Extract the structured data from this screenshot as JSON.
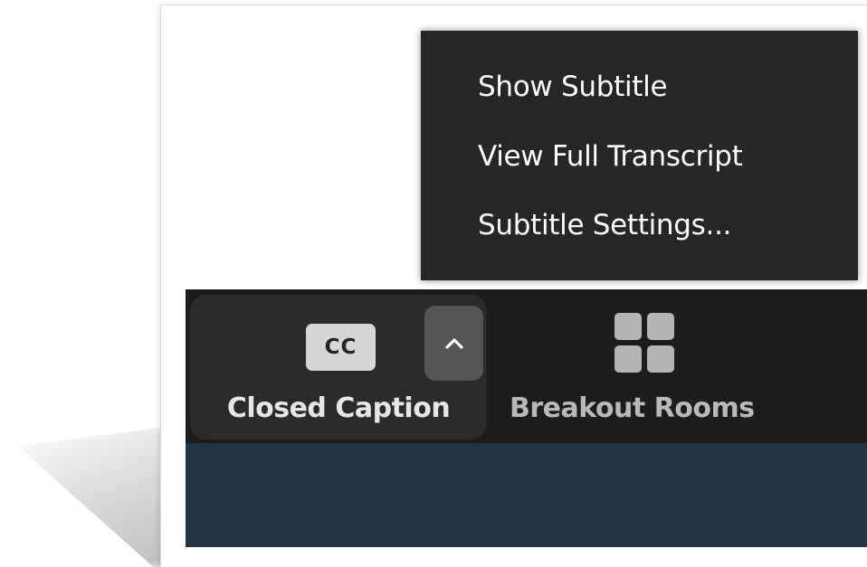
{
  "menu": {
    "items": [
      {
        "label": "Show Subtitle"
      },
      {
        "label": "View Full Transcript"
      },
      {
        "label": "Subtitle Settings..."
      }
    ]
  },
  "toolbar": {
    "closed_caption": {
      "badge": "CC",
      "label": "Closed Caption",
      "caret_icon": "chevron-up-icon"
    },
    "breakout_rooms": {
      "label": "Breakout Rooms",
      "icon": "grid-icon"
    }
  },
  "colors": {
    "menu_bg": "#262626",
    "toolbar_bg": "#1c1c1c",
    "cc_group_bg": "#2b2b2b",
    "caret_bg": "#555555",
    "video_bg": "#243442"
  }
}
